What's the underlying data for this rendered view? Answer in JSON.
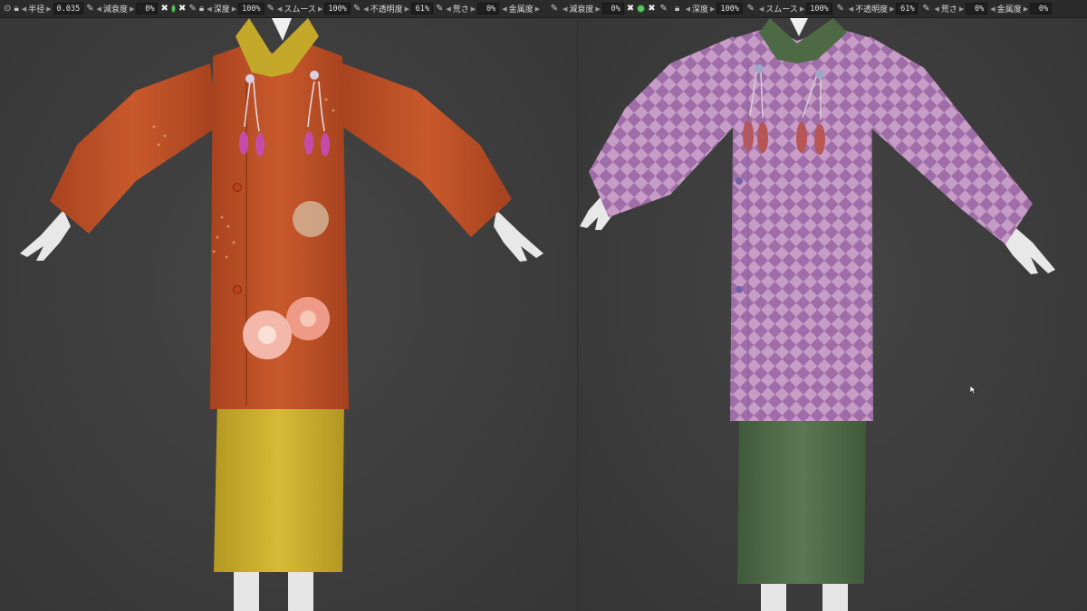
{
  "toolbar_left": {
    "radius_label": "半径",
    "radius_value": "0.035",
    "falloff_label": "減衰度",
    "falloff_value": "0%",
    "depth_label": "深度",
    "depth_value": "100%",
    "smooth_label": "スムース",
    "smooth_value": "100%",
    "opacity_label": "不透明度",
    "opacity_value": "61%",
    "roughness_label": "荒さ",
    "roughness_value": "0%",
    "metallic_label": "金属度"
  },
  "toolbar_right": {
    "falloff_label": "減衰度",
    "falloff_value": "0%",
    "depth_label": "深度",
    "depth_value": "100%",
    "smooth_label": "スムース",
    "smooth_value": "100%",
    "opacity_label": "不透明度",
    "opacity_value": "61%",
    "roughness_label": "荒さ",
    "roughness_value": "0%",
    "metallic_label": "金属度",
    "metallic_value": "0%"
  },
  "colors": {
    "orange_coat": "#c2532a",
    "yellow_skirt": "#c9ad2c",
    "purple_coat": "#b488b8",
    "green_skirt": "#4f6b48",
    "accent_green": "#5ac85a"
  }
}
